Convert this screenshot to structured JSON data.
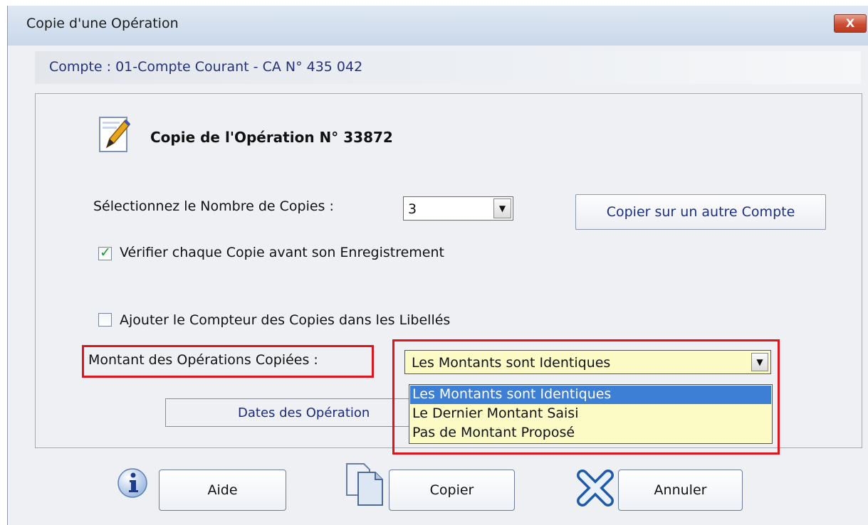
{
  "window": {
    "title": "Copie d'une Opération",
    "close_label": "X"
  },
  "account": {
    "label": "Compte : 01-Compte Courant - CA N° 435 042"
  },
  "operation": {
    "title": "Copie de l'Opération N° 33872"
  },
  "copies": {
    "label": "Sélectionnez le Nombre de Copies :",
    "value": "3"
  },
  "other_account_button": "Copier sur un autre Compte",
  "verify": {
    "label": "Vérifier chaque Copie avant son Enregistrement",
    "checked": true
  },
  "counter": {
    "label": "Ajouter le Compteur des Copies dans les Libellés",
    "checked": false
  },
  "amount": {
    "label": "Montant des Opérations Copiées :",
    "selected": "Les Montants sont Identiques",
    "options": [
      "Les Montants sont Identiques",
      "Le Dernier Montant Saisi",
      "Pas de Montant Proposé"
    ]
  },
  "dates_button": "Dates des Opération",
  "buttons": {
    "help": "Aide",
    "copy": "Copier",
    "cancel": "Annuler"
  },
  "icons": {
    "document": "document-pen-icon",
    "info": "info-icon",
    "copy": "copy-icon",
    "cancel": "cancel-x-icon"
  },
  "colors": {
    "highlight": "#e0151b",
    "dropdown_bg": "#fdfbc5",
    "selection": "#3d7fd5",
    "link_text": "#1b3083"
  }
}
